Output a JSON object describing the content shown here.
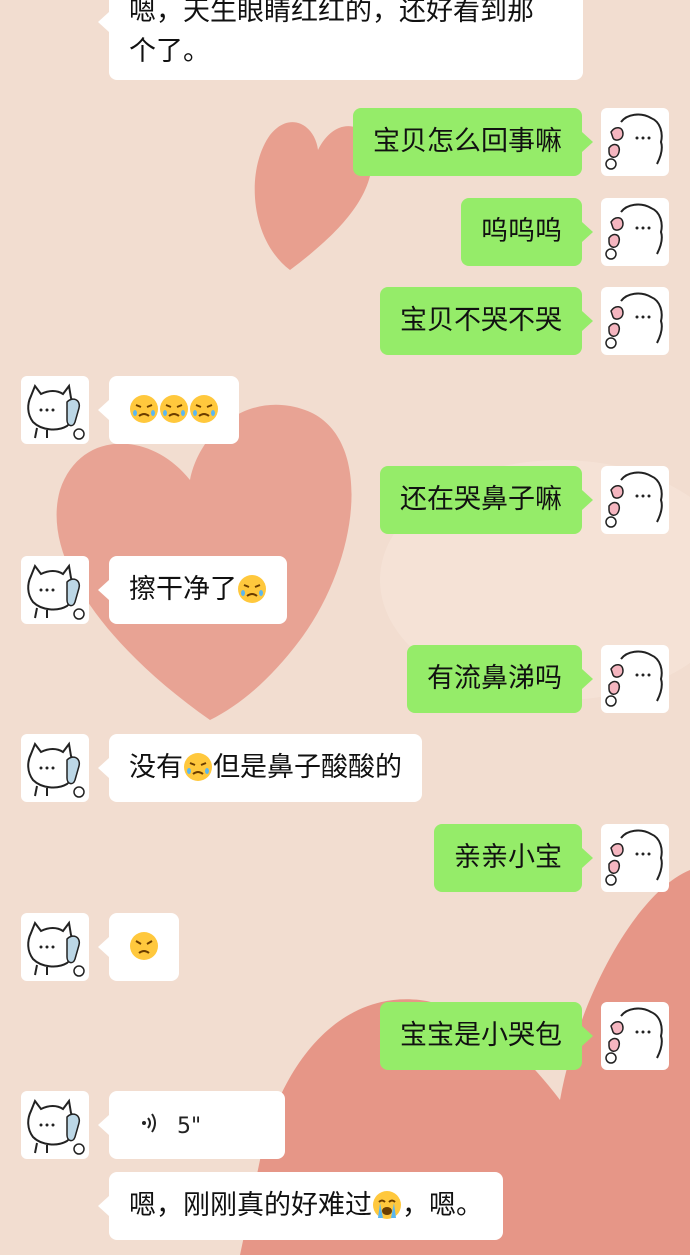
{
  "chat": {
    "colors": {
      "outgoing_bubble": "#95ec69",
      "incoming_bubble": "#ffffff",
      "wallpaper": "#f2ddd0",
      "heart": "#e48a7a"
    },
    "messages": [
      {
        "side": "in",
        "line1": "嗯，天生眼睛红红的，还好看到那",
        "line2": "个了。"
      },
      {
        "side": "out",
        "text": "宝贝怎么回事嘛"
      },
      {
        "side": "out",
        "text": "呜呜呜"
      },
      {
        "side": "out",
        "text": "宝贝不哭不哭"
      },
      {
        "side": "in",
        "emoji": [
          "tearful-angry-emoji",
          "tearful-angry-emoji",
          "tearful-angry-emoji"
        ]
      },
      {
        "side": "out",
        "text": "还在哭鼻子嘛"
      },
      {
        "side": "in",
        "text": "擦干净了",
        "emoji": [
          "tearful-angry-emoji"
        ]
      },
      {
        "side": "out",
        "text": "有流鼻涕吗"
      },
      {
        "side": "in",
        "before": "没有",
        "after": "但是鼻子酸酸的",
        "emoji": [
          "tearful-angry-emoji"
        ]
      },
      {
        "side": "out",
        "text": "亲亲小宝"
      },
      {
        "side": "in",
        "emoji": [
          "angry-emoji"
        ]
      },
      {
        "side": "out",
        "text": "宝宝是小哭包"
      },
      {
        "side": "in",
        "type": "voice",
        "duration": "5\""
      },
      {
        "side": "in",
        "before": "嗯，刚刚真的好难过",
        "after": "，嗯。",
        "emoji": [
          "crying-emoji"
        ]
      }
    ]
  }
}
